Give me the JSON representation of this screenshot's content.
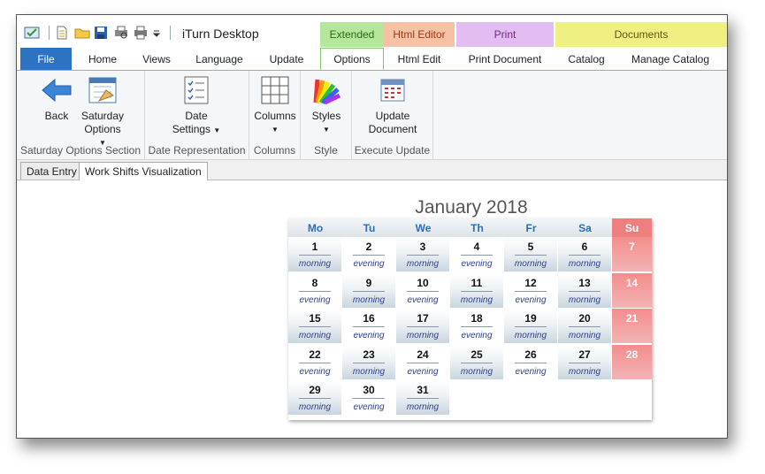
{
  "app": {
    "title": "iTurn Desktop"
  },
  "context_groups": {
    "extended": "Extended",
    "html_editor": "Html Editor",
    "print": "Print",
    "documents": "Documents"
  },
  "tabs": {
    "file": "File",
    "home": "Home",
    "views": "Views",
    "language": "Language",
    "update": "Update",
    "options": "Options",
    "html_edit": "Html Edit",
    "print_document": "Print Document",
    "catalog": "Catalog",
    "manage_catalog": "Manage Catalog"
  },
  "ribbon": {
    "back": "Back",
    "saturday_line1": "Saturday",
    "saturday_line2": "Options",
    "saturday_group": "Saturday Options Section",
    "date_line1": "Date",
    "date_line2": "Settings",
    "date_group": "Date Representation",
    "columns": "Columns",
    "columns_group": "Columns",
    "styles": "Styles",
    "style_group": "Style",
    "update_line1": "Update",
    "update_line2": "Document",
    "update_group": "Execute Update"
  },
  "doc_tabs": {
    "data_entry": "Data Entry",
    "work_shifts": "Work Shifts Visualization"
  },
  "calendar": {
    "title": "January 2018",
    "days": [
      "Mo",
      "Tu",
      "We",
      "Th",
      "Fr",
      "Sa",
      "Su"
    ],
    "weeks": [
      [
        {
          "d": "1",
          "s": "morning"
        },
        {
          "d": "2",
          "s": "evening"
        },
        {
          "d": "3",
          "s": "morning"
        },
        {
          "d": "4",
          "s": "evening"
        },
        {
          "d": "5",
          "s": "morning"
        },
        {
          "d": "6",
          "s": "morning"
        },
        {
          "d": "7",
          "s": ""
        }
      ],
      [
        {
          "d": "8",
          "s": "evening"
        },
        {
          "d": "9",
          "s": "morning"
        },
        {
          "d": "10",
          "s": "evening"
        },
        {
          "d": "11",
          "s": "morning"
        },
        {
          "d": "12",
          "s": "evening"
        },
        {
          "d": "13",
          "s": "morning"
        },
        {
          "d": "14",
          "s": ""
        }
      ],
      [
        {
          "d": "15",
          "s": "morning"
        },
        {
          "d": "16",
          "s": "evening"
        },
        {
          "d": "17",
          "s": "morning"
        },
        {
          "d": "18",
          "s": "evening"
        },
        {
          "d": "19",
          "s": "morning"
        },
        {
          "d": "20",
          "s": "morning"
        },
        {
          "d": "21",
          "s": ""
        }
      ],
      [
        {
          "d": "22",
          "s": "evening"
        },
        {
          "d": "23",
          "s": "morning"
        },
        {
          "d": "24",
          "s": "evening"
        },
        {
          "d": "25",
          "s": "morning"
        },
        {
          "d": "26",
          "s": "evening"
        },
        {
          "d": "27",
          "s": "morning"
        },
        {
          "d": "28",
          "s": ""
        }
      ],
      [
        {
          "d": "29",
          "s": "morning"
        },
        {
          "d": "30",
          "s": "evening"
        },
        {
          "d": "31",
          "s": "morning"
        }
      ]
    ]
  },
  "colors": {
    "file_tab": "#2d73c4",
    "sunday": "#ef7f7f",
    "weekday_header": "#2c6fb8",
    "shift_text": "#2e3d8c"
  }
}
